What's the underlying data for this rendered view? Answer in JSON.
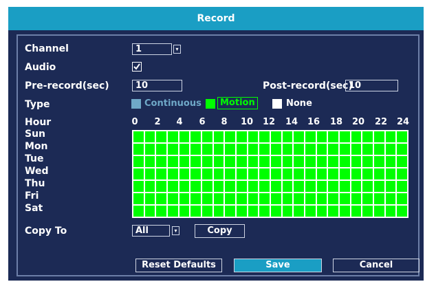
{
  "window": {
    "title": "Record"
  },
  "form": {
    "channel": {
      "label": "Channel",
      "value": "1"
    },
    "audio": {
      "label": "Audio",
      "checked": true
    },
    "pre_record": {
      "label": "Pre-record(sec)",
      "value": "10"
    },
    "post_record": {
      "label": "Post-record(sec)",
      "value": "10"
    },
    "type": {
      "label": "Type",
      "options": [
        {
          "label": "Continuous",
          "color": "#6fa8c8",
          "selected": false
        },
        {
          "label": "Motion",
          "color": "#00ff00",
          "selected": true
        },
        {
          "label": "None",
          "color": "#ffffff",
          "selected": false
        }
      ]
    },
    "copy_to": {
      "label": "Copy To",
      "value": "All"
    }
  },
  "schedule": {
    "hour_label": "Hour",
    "hour_ticks": [
      "0",
      "2",
      "4",
      "6",
      "8",
      "10",
      "12",
      "14",
      "16",
      "18",
      "20",
      "22",
      "24"
    ],
    "days": [
      "Sun",
      "Mon",
      "Tue",
      "Wed",
      "Thu",
      "Fri",
      "Sat"
    ],
    "slots_per_day": 24,
    "fill_type": "Motion",
    "fill_color": "#00ff00"
  },
  "buttons": {
    "copy": "Copy",
    "reset_defaults": "Reset Defaults",
    "save": "Save",
    "cancel": "Cancel"
  },
  "icons": {
    "dropdown": "chevron-down-icon",
    "audio_check": "checkmark-icon"
  }
}
